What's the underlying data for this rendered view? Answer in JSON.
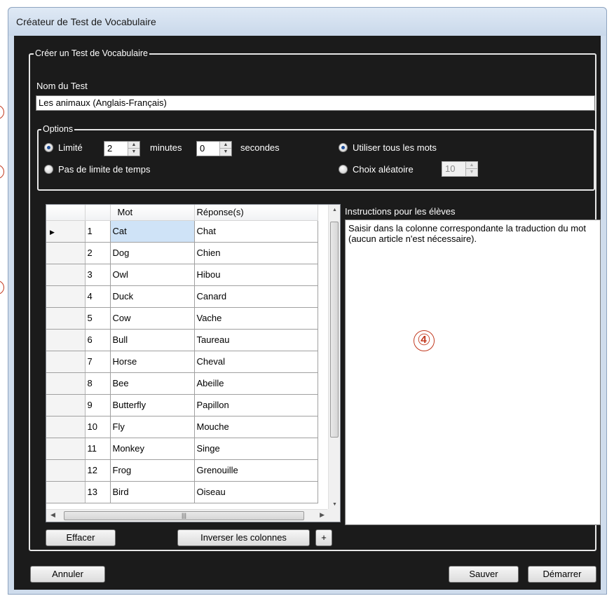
{
  "window": {
    "title": "Créateur de Test de Vocabulaire"
  },
  "group_main": {
    "legend": "Créer un Test de Vocabulaire"
  },
  "test_name": {
    "label": "Nom du Test",
    "value": "Les animaux (Anglais-Français)"
  },
  "options": {
    "legend": "Options",
    "limited_label": "Limité",
    "minutes_value": "2",
    "minutes_label": "minutes",
    "seconds_value": "0",
    "seconds_label": "secondes",
    "no_limit_label": "Pas de limite de temps",
    "use_all_words_label": "Utiliser tous les mots",
    "random_choice_label": "Choix aléatoire",
    "random_count_value": "10",
    "selected_time_mode": "Limité",
    "selected_word_mode": "Utiliser tous les mots"
  },
  "grid": {
    "columns": [
      "Mot",
      "Réponse(s)"
    ],
    "rows": [
      {
        "n": "1",
        "word": "Cat",
        "answer": "Chat"
      },
      {
        "n": "2",
        "word": "Dog",
        "answer": "Chien"
      },
      {
        "n": "3",
        "word": "Owl",
        "answer": "Hibou"
      },
      {
        "n": "4",
        "word": "Duck",
        "answer": "Canard"
      },
      {
        "n": "5",
        "word": "Cow",
        "answer": "Vache"
      },
      {
        "n": "6",
        "word": "Bull",
        "answer": "Taureau"
      },
      {
        "n": "7",
        "word": "Horse",
        "answer": "Cheval"
      },
      {
        "n": "8",
        "word": "Bee",
        "answer": "Abeille"
      },
      {
        "n": "9",
        "word": "Butterfly",
        "answer": "Papillon"
      },
      {
        "n": "10",
        "word": "Fly",
        "answer": "Mouche"
      },
      {
        "n": "11",
        "word": "Monkey",
        "answer": "Singe"
      },
      {
        "n": "12",
        "word": "Frog",
        "answer": "Grenouille"
      },
      {
        "n": "13",
        "word": "Bird",
        "answer": "Oiseau"
      }
    ]
  },
  "instructions": {
    "label": "Instructions pour les élèves",
    "text": "Saisir dans la colonne correspondante la traduction du mot (aucun article n'est nécessaire)."
  },
  "annotation": {
    "marker": "④"
  },
  "buttons": {
    "clear": "Effacer",
    "swap_columns": "Inverser les colonnes",
    "plus": "+",
    "cancel": "Annuler",
    "save": "Sauver",
    "start": "Démarrer"
  },
  "colors": {
    "dialog_background": "#1b1b1b",
    "annotation": "#c23a20",
    "selection": "#cfe3f7"
  }
}
